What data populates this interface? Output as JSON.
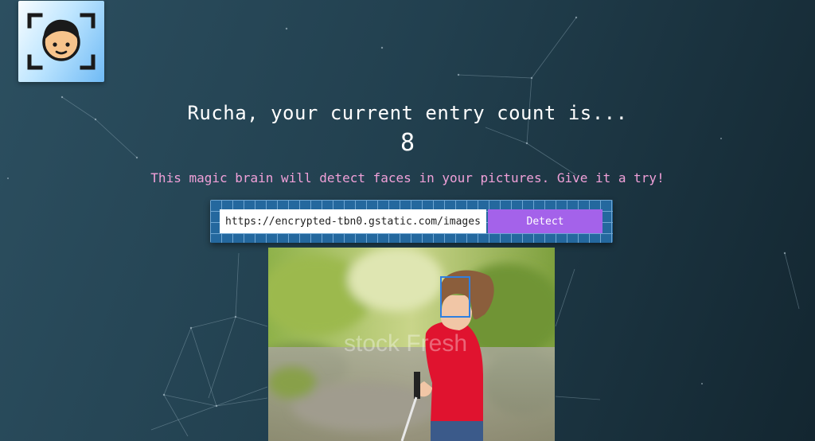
{
  "header": {
    "greeting": "Rucha, your current entry count is...",
    "entry_count": "8",
    "tagline": "This magic brain will detect faces in your pictures. Give it a try!"
  },
  "logo": {
    "icon": "face-scan-icon"
  },
  "form": {
    "url_value": "https://encrypted-tbn0.gstatic.com/images",
    "detect_label": "Detect"
  },
  "image": {
    "watermark": "stock Fresh",
    "face_detected": true
  },
  "colors": {
    "accent": "#a462ea",
    "tagline": "#f0a0d8",
    "panel": "#24689e",
    "face_box": "#2f7fe0"
  }
}
